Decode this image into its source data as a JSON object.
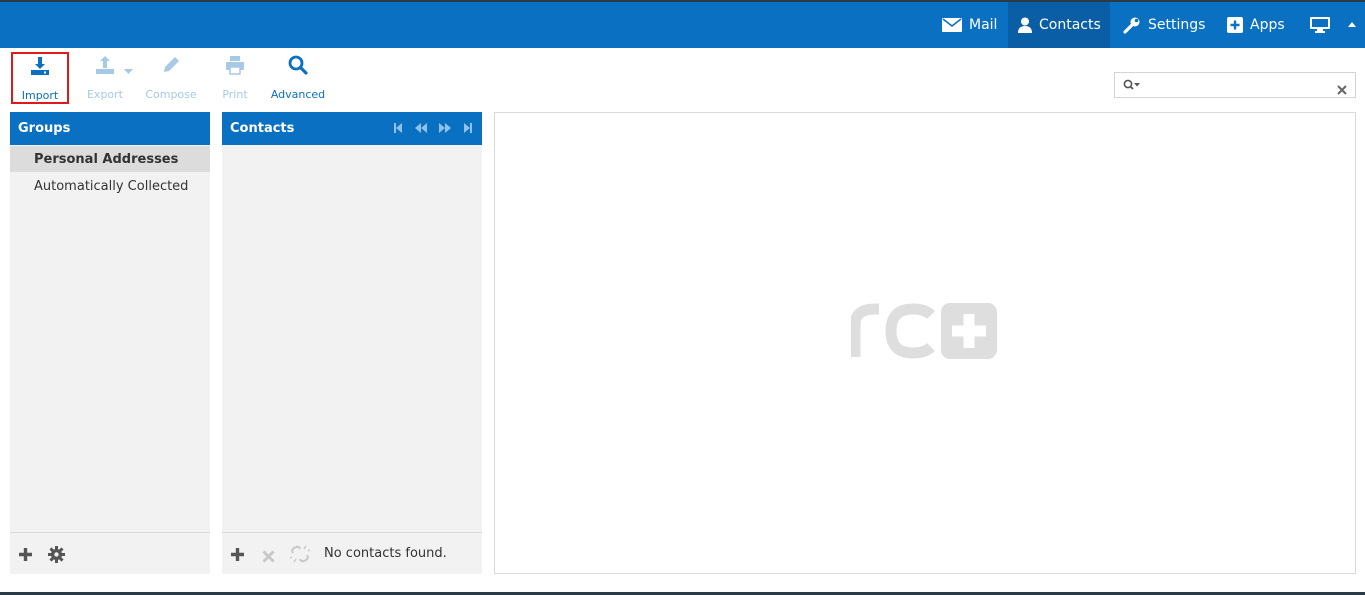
{
  "nav": {
    "mail": "Mail",
    "contacts": "Contacts",
    "settings": "Settings",
    "apps": "Apps"
  },
  "toolbar": {
    "import": "Import",
    "export": "Export",
    "compose": "Compose",
    "print": "Print",
    "advanced": "Advanced"
  },
  "groups": {
    "title": "Groups",
    "items": [
      {
        "label": "Personal Addresses",
        "selected": true
      },
      {
        "label": "Automatically Collected",
        "selected": false
      }
    ]
  },
  "contacts": {
    "title": "Contacts",
    "status": "No contacts found."
  },
  "search": {
    "value": ""
  },
  "colors": {
    "accent": "#0a70c2",
    "highlight": "#e01a1a",
    "panel": "#f2f2f2"
  }
}
